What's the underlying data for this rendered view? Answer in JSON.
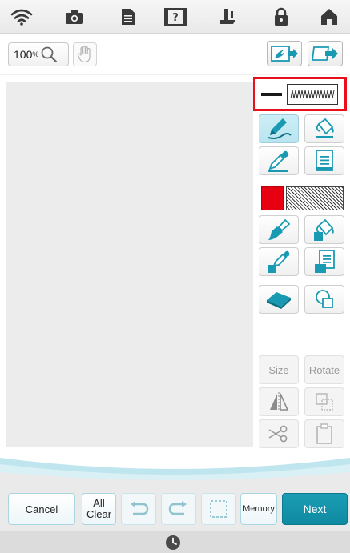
{
  "status_bar": {
    "icons": [
      "wifi-icon",
      "camera-icon",
      "document-icon",
      "help-icon",
      "presser-foot-icon",
      "lock-icon",
      "home-icon"
    ]
  },
  "toolbar": {
    "zoom_value": "100",
    "zoom_unit": "%",
    "hand_icon": "hand-icon",
    "import_icon": "import-image-icon",
    "export_icon": "export-icon"
  },
  "tools": {
    "line_selector": {
      "solid": "solid-line",
      "stitch": "zigzag-stitch"
    },
    "fill_selector": {
      "color": "#e60012",
      "stitch": "hatched-fill"
    },
    "size_label": "Size",
    "rotate_label": "Rotate"
  },
  "bottom": {
    "cancel_label": "Cancel",
    "all_clear_line1": "All",
    "all_clear_line2": "Clear",
    "memory_label": "Memory",
    "next_label": "Next"
  },
  "colors": {
    "accent": "#1a9ab2",
    "highlight": "#e8101a",
    "fill_red": "#e60012"
  }
}
